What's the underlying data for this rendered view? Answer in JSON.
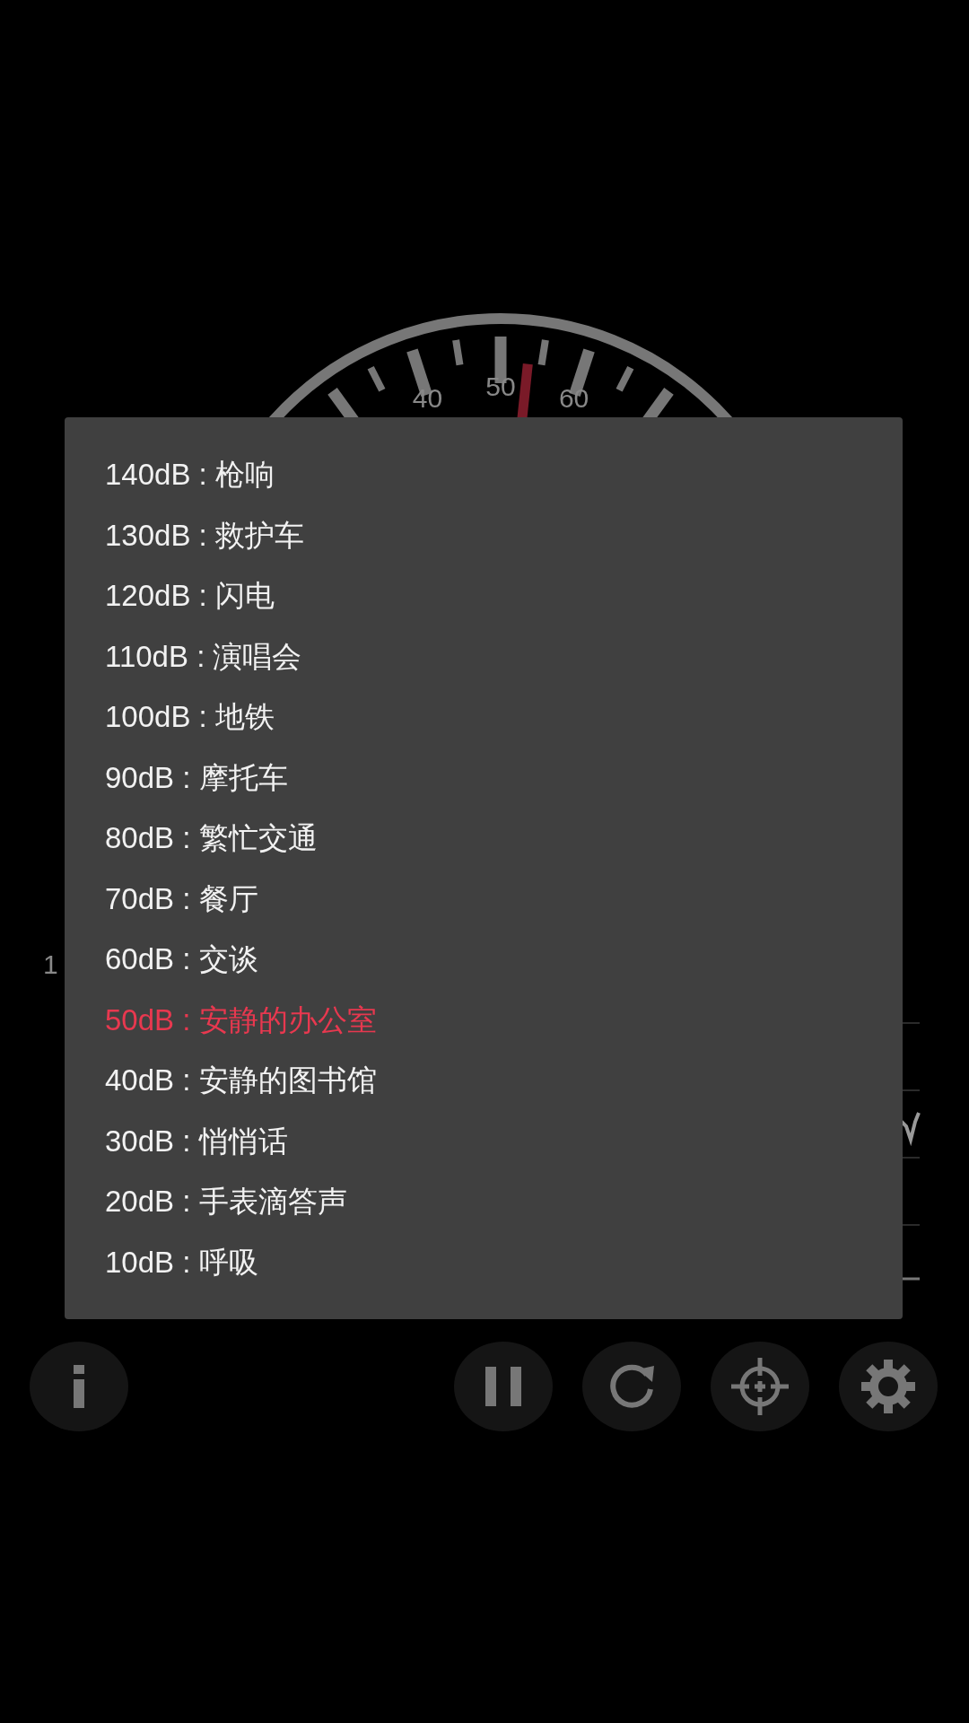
{
  "gauge": {
    "labels": [
      "40",
      "50",
      "60"
    ]
  },
  "chart": {
    "axis_label": "1"
  },
  "reference_menu": {
    "items": [
      {
        "label": "140dB : 枪响",
        "selected": false
      },
      {
        "label": "130dB : 救护车",
        "selected": false
      },
      {
        "label": "120dB : 闪电",
        "selected": false
      },
      {
        "label": "110dB : 演唱会",
        "selected": false
      },
      {
        "label": "100dB : 地铁",
        "selected": false
      },
      {
        "label": "90dB : 摩托车",
        "selected": false
      },
      {
        "label": "80dB : 繁忙交通",
        "selected": false
      },
      {
        "label": "70dB : 餐厅",
        "selected": false
      },
      {
        "label": "60dB : 交谈",
        "selected": false
      },
      {
        "label": "50dB : 安静的办公室",
        "selected": true
      },
      {
        "label": "40dB : 安静的图书馆",
        "selected": false
      },
      {
        "label": "30dB : 悄悄话",
        "selected": false
      },
      {
        "label": "20dB : 手表滴答声",
        "selected": false
      },
      {
        "label": "10dB : 呼吸",
        "selected": false
      }
    ]
  },
  "toolbar": {
    "left": [
      {
        "kind": "info"
      }
    ],
    "right": [
      {
        "kind": "pause"
      },
      {
        "kind": "refresh"
      },
      {
        "kind": "target"
      },
      {
        "kind": "settings"
      }
    ]
  }
}
